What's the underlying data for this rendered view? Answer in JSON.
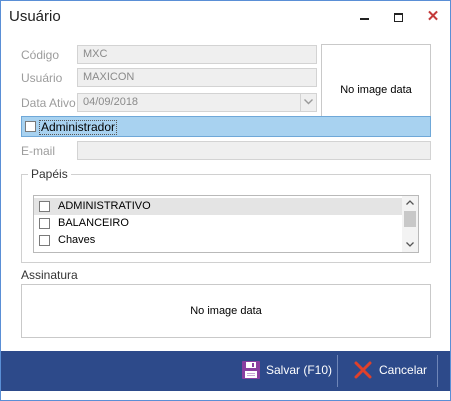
{
  "window": {
    "title": "Usuário",
    "controls": {
      "minimize": "minimize-icon",
      "maximize": "maximize-icon",
      "close": "close-icon",
      "close_glyph": "✕"
    }
  },
  "form": {
    "codigo": {
      "label": "Código",
      "value": "MXC"
    },
    "usuario": {
      "label": "Usuário",
      "value": "MAXICON"
    },
    "data_ativo": {
      "label": "Data Ativo",
      "value": "04/09/2018"
    },
    "administrador": {
      "label": "Administrador",
      "checked": false
    },
    "email": {
      "label": "E-mail",
      "value": ""
    }
  },
  "photo": {
    "text": "No image data"
  },
  "papeis": {
    "title": "Papéis",
    "items": [
      {
        "label": "ADMINISTRATIVO",
        "checked": false,
        "selected": true
      },
      {
        "label": "BALANCEIRO",
        "checked": false,
        "selected": false
      },
      {
        "label": "Chaves",
        "checked": false,
        "selected": false
      }
    ]
  },
  "assinatura": {
    "label": "Assinatura",
    "text": "No image data"
  },
  "footer": {
    "save_label": "Salvar (F10)",
    "cancel_label": "Cancelar"
  },
  "colors": {
    "footer_bg": "#2d4a8a",
    "selection": "#a8d2f0",
    "save_icon": "#8a3fa0",
    "cancel_icon": "#e0402a"
  }
}
